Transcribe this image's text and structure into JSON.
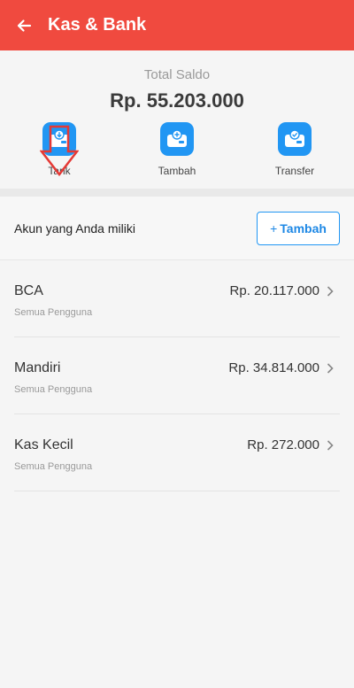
{
  "appbar": {
    "title": "Kas & Bank",
    "back_icon": "arrow-left-icon",
    "color": "#f04a3f"
  },
  "summary": {
    "label": "Total Saldo",
    "value": "Rp. 55.203.000"
  },
  "actions": [
    {
      "label": "Tarik",
      "icon": "wallet-withdraw-icon"
    },
    {
      "label": "Tambah",
      "icon": "wallet-add-icon"
    },
    {
      "label": "Transfer",
      "icon": "wallet-transfer-icon"
    }
  ],
  "accounts_section": {
    "title": "Akun yang Anda miliki",
    "add_plus": "+",
    "add_label": "Tambah"
  },
  "accounts": [
    {
      "name": "BCA",
      "subtitle": "Semua Pengguna",
      "balance": "Rp. 20.117.000"
    },
    {
      "name": "Mandiri",
      "subtitle": "Semua Pengguna",
      "balance": "Rp. 34.814.000"
    },
    {
      "name": "Kas Kecil",
      "subtitle": "Semua Pengguna",
      "balance": "Rp. 272.000"
    }
  ],
  "colors": {
    "accent_blue": "#2196f3",
    "annotation_red": "#e53935"
  }
}
